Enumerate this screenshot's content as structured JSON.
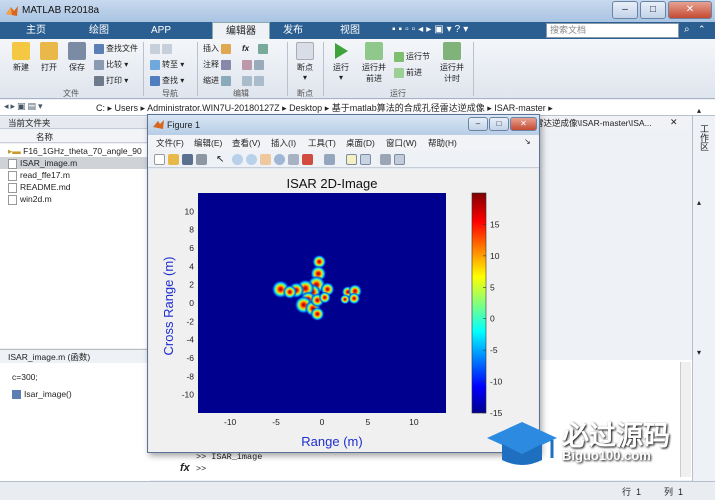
{
  "app": {
    "title": "MATLAB R2018a"
  },
  "tabs": [
    "主页",
    "绘图",
    "APP",
    "编辑器",
    "发布",
    "视图"
  ],
  "search_placeholder": "搜索文档",
  "ribbon": {
    "file_group": {
      "label": "文件",
      "new": "新建",
      "open": "打开",
      "save": "保存",
      "find_files": "查找文件",
      "compare": "比较",
      "print": "打印"
    },
    "nav_group": {
      "label": "导航",
      "goto": "转至",
      "find": "查找"
    },
    "edit_group": {
      "label": "编辑",
      "insert": "插入",
      "comment": "注释",
      "indent": "缩进",
      "fx": "fx"
    },
    "breakpoint_group": {
      "label": "断点",
      "breakpoints": "断点"
    },
    "run_group": {
      "label": "运行",
      "run": "运行",
      "run_advance": "运行并\n前进",
      "run_section": "运行节",
      "advance": "前进",
      "run_time": "运行并\n计时"
    }
  },
  "address": {
    "segments": [
      "C:",
      "Users",
      "Administrator.WIN7U-20180127Z",
      "Desktop",
      "基于matlab算法的合成孔径雷达逆成像",
      "ISAR-master"
    ]
  },
  "current_folder": {
    "header": "当前文件夹",
    "column": "名称",
    "files": [
      "F16_1GHz_theta_70_angle_90",
      "ISAR_image.m",
      "read_ffe17.m",
      "README.md",
      "win2d.m"
    ]
  },
  "details": {
    "header": "ISAR_image.m  (函数)",
    "line1": "c=300;",
    "line2": "Isar_image()"
  },
  "editor_tab": "雷达逆成像\\ISAR-master\\ISA...",
  "workspace_label": "工作区",
  "command": {
    "line": ">> ISAR_image",
    "prompt": ">>",
    "fx": "fx"
  },
  "status": {
    "row": "行",
    "row_val": "1",
    "col": "列",
    "col_val": "1"
  },
  "figure": {
    "title": "Figure 1",
    "menus": [
      "文件(F)",
      "编辑(E)",
      "查看(V)",
      "插入(I)",
      "工具(T)",
      "桌面(D)",
      "窗口(W)",
      "帮助(H)"
    ]
  },
  "chart_data": {
    "type": "heatmap",
    "title": "ISAR 2D-Image",
    "xlabel": "Range (m)",
    "ylabel": "Cross Range (m)",
    "xlim": [
      -13.5,
      13.5
    ],
    "ylim": [
      -12,
      12
    ],
    "xticks": [
      -10,
      -5,
      0,
      5,
      10
    ],
    "yticks": [
      10,
      8,
      6,
      4,
      2,
      0,
      -2,
      -4,
      -6,
      -8,
      -10
    ],
    "colorbar": {
      "range": [
        -15,
        20
      ],
      "ticks": [
        15,
        10,
        5,
        0,
        -5,
        -10,
        -15
      ],
      "colormap": "jet"
    },
    "background_color": "#00008f",
    "scatterers": [
      {
        "x": -0.3,
        "y": 4.5,
        "r": 0.7
      },
      {
        "x": -0.4,
        "y": 3.2,
        "r": 0.8
      },
      {
        "x": -0.6,
        "y": 2.0,
        "r": 0.9
      },
      {
        "x": -1.0,
        "y": 1.2,
        "r": 0.8
      },
      {
        "x": -1.8,
        "y": 1.6,
        "r": 0.9
      },
      {
        "x": -2.8,
        "y": 1.4,
        "r": 0.8
      },
      {
        "x": -4.5,
        "y": 1.5,
        "r": 0.9
      },
      {
        "x": -3.5,
        "y": 1.2,
        "r": 0.7
      },
      {
        "x": -1.5,
        "y": 0.4,
        "r": 0.8
      },
      {
        "x": -2.0,
        "y": -0.2,
        "r": 0.9
      },
      {
        "x": -1.0,
        "y": -0.6,
        "r": 0.8
      },
      {
        "x": -0.5,
        "y": 0.3,
        "r": 0.7
      },
      {
        "x": 0.6,
        "y": 1.5,
        "r": 0.7
      },
      {
        "x": 0.3,
        "y": 0.6,
        "r": 0.6
      },
      {
        "x": -0.5,
        "y": -1.2,
        "r": 0.7
      },
      {
        "x": 2.8,
        "y": 1.2,
        "r": 0.6
      },
      {
        "x": 3.6,
        "y": 1.3,
        "r": 0.7
      },
      {
        "x": 3.5,
        "y": 0.5,
        "r": 0.6
      },
      {
        "x": 2.5,
        "y": 0.4,
        "r": 0.5
      }
    ]
  },
  "watermark": {
    "text": "必过源码",
    "url": "Biguo100.com"
  }
}
